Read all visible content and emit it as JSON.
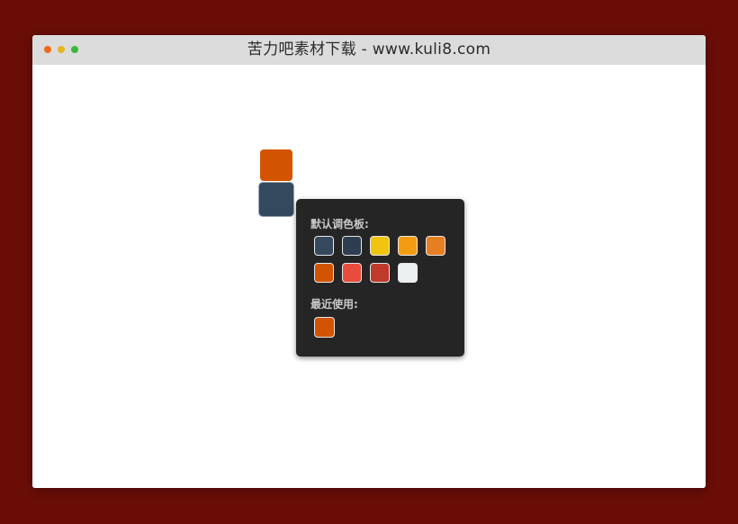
{
  "window": {
    "title": "苦力吧素材下载 - www.kuli8.com"
  },
  "trigger_swatches": {
    "top_color": "#d35400",
    "bottom_color": "#34495e"
  },
  "picker": {
    "default_label": "默认调色板:",
    "recent_label": "最近使用:",
    "default_colors": [
      "#34495e",
      "#2c3e50",
      "#f1c40f",
      "#f39c12",
      "#e67e22",
      "#d35400",
      "#e74c3c",
      "#c0392b",
      "#ecf0f1"
    ],
    "recent_colors": [
      "#d35400"
    ]
  }
}
